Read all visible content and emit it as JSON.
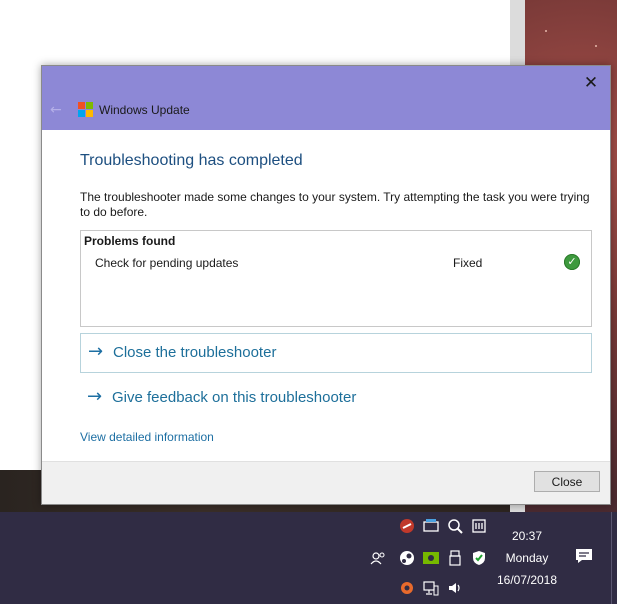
{
  "dialog": {
    "title": "Windows Update",
    "back_icon": "back-arrow-icon",
    "close_icon": "close-icon",
    "heading": "Troubleshooting has completed",
    "description": "The troubleshooter made some changes to your system. Try attempting the task you were trying to do before.",
    "problems": {
      "title": "Problems found",
      "items": [
        {
          "name": "Check for pending updates",
          "status": "Fixed",
          "icon": "check-circle-icon"
        }
      ]
    },
    "links": [
      {
        "label": "Close the troubleshooter",
        "icon": "arrow-right-icon"
      },
      {
        "label": "Give feedback on this troubleshooter",
        "icon": "arrow-right-icon"
      }
    ],
    "detail_link": "View detailed information",
    "footer": {
      "close_button": "Close"
    }
  },
  "taskbar": {
    "time": "20:37",
    "day": "Monday",
    "date": "16/07/2018",
    "tray_icons": [
      "app-tray-icon-1",
      "keyboard-icon",
      "gpu-tray-icon",
      "app-tray-icon-4",
      "people-icon",
      "steam-icon",
      "nvidia-icon",
      "usb-icon",
      "security-shield-icon",
      "record-icon",
      "network-icon",
      "volume-icon",
      "action-center-icon"
    ]
  },
  "colors": {
    "titlebar": "#8d88d6",
    "link": "#1d6f9a",
    "heading": "#1d4f80",
    "taskbar": "#302c44",
    "check": "#3e9a3e"
  }
}
